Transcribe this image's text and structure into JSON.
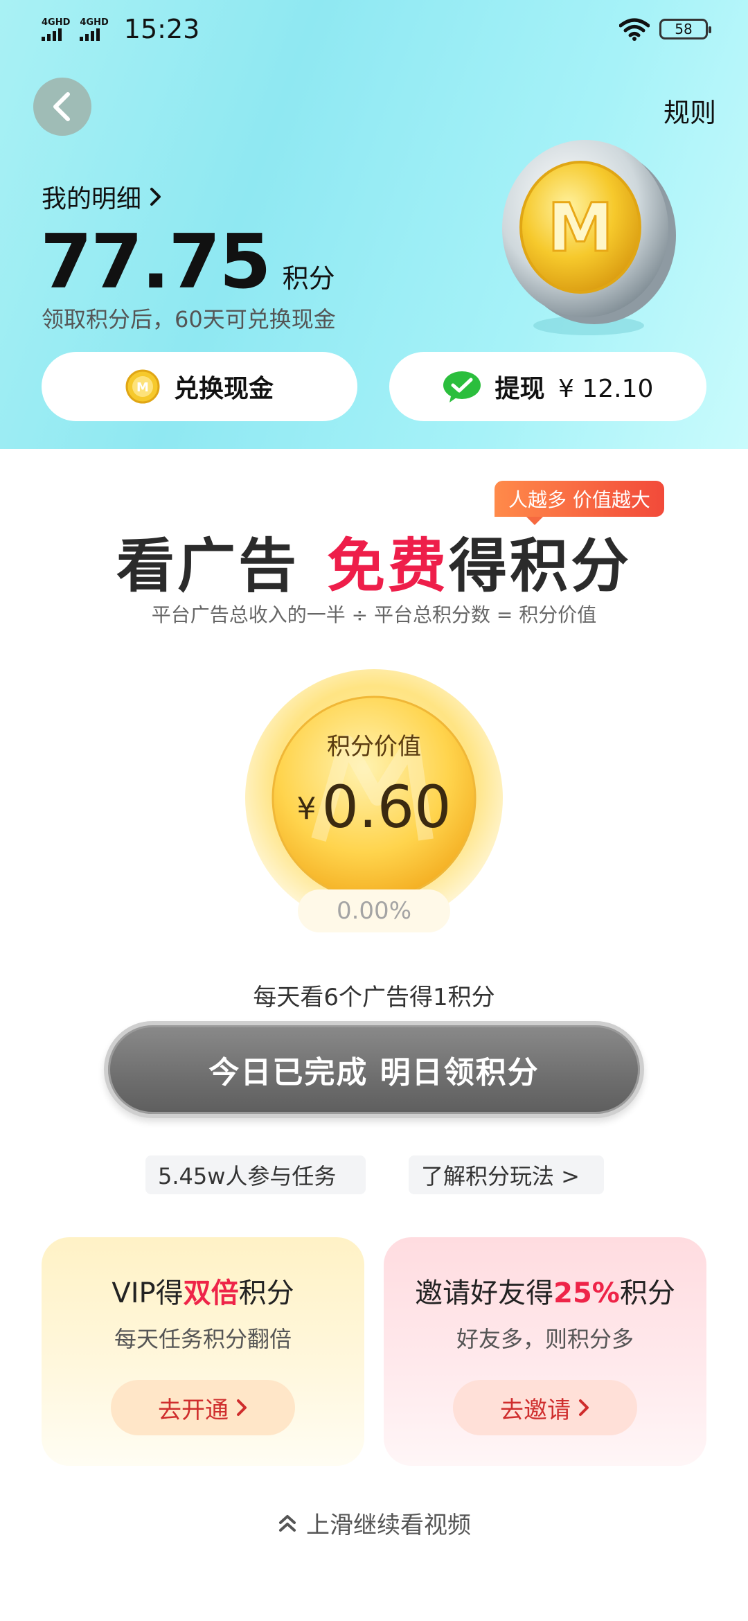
{
  "status_bar": {
    "network_labels": [
      "4GHD",
      "4GHD"
    ],
    "time": "15:23",
    "battery": "58",
    "wifi_icon": "wifi-icon"
  },
  "header": {
    "back_icon": "chevron-left-icon",
    "rules": "规则",
    "detail_link": "我的明细",
    "points_value": "77.75",
    "points_unit": "积分",
    "points_note": "领取积分后，60天可兑换现金",
    "exchange_label": "兑换现金",
    "withdraw_label": "提现",
    "withdraw_amount": "¥ 12.10",
    "coin_glyph": "M"
  },
  "promo_badge": "人越多 价值越大",
  "headline": {
    "part1": "看广告",
    "highlight": "免费",
    "part2": "得积分"
  },
  "formula": "平台广告总收入的一半 ÷ 平台总积分数 = 积分价值",
  "value_coin": {
    "label": "积分价值",
    "currency": "¥",
    "amount": "0.60",
    "change": "0.00%"
  },
  "daily_rule": "每天看6个广告得1积分",
  "done_button": "今日已完成 明日领积分",
  "chips": {
    "participants": "5.45w人参与任务",
    "learn_more": "了解积分玩法 >"
  },
  "promo_cards": {
    "vip": {
      "title_pre": "VIP得",
      "title_highlight": "双倍",
      "title_post": "积分",
      "subtitle": "每天任务积分翻倍",
      "button": "去开通"
    },
    "invite": {
      "title_pre": "邀请好友得",
      "title_highlight": "25%",
      "title_post": "积分",
      "subtitle": "好友多，则积分多",
      "button": "去邀请"
    }
  },
  "swipe_hint": "上滑继续看视频",
  "colors": {
    "accent_red": "#ee1e4a",
    "header_teal": "#8fe8f2",
    "gold": "#f4b422",
    "wechat_green": "#2bbe3d"
  }
}
